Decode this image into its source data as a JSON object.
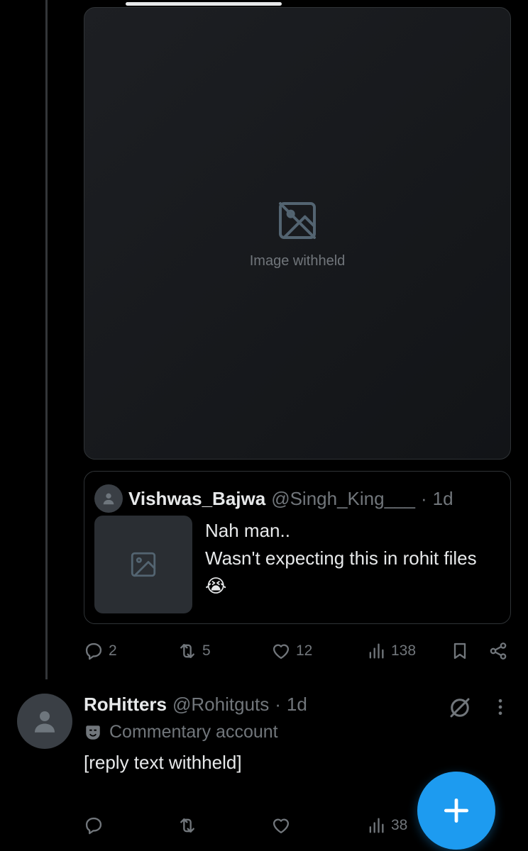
{
  "top_media": {
    "note": "Image withheld"
  },
  "quote": {
    "name": "Vishwas_Bajwa",
    "handle": "@Singh_King___",
    "separator": "·",
    "time": "1d",
    "lines": [
      "Nah man..",
      "Wasn't expecting this in rohit files 😭"
    ]
  },
  "actions": {
    "replies": "2",
    "reposts": "5",
    "likes": "12",
    "views": "138"
  },
  "reply": {
    "name": "RoHitters",
    "handle": "@Rohitguts",
    "separator": "·",
    "time": "1d",
    "badge": "Commentary account",
    "body": "[reply text withheld]",
    "views": "38"
  },
  "icons": {
    "reply": "reply-icon",
    "repost": "repost-icon",
    "like": "like-icon",
    "views": "views-icon",
    "bookmark": "bookmark-icon",
    "share": "share-icon",
    "grok": "grok-icon",
    "more": "more-icon",
    "commentary": "commentary-icon",
    "compose": "compose-icon"
  },
  "colors": {
    "background": "#000000",
    "text": "#e7e9ea",
    "muted": "#71767b",
    "border": "#2f3336",
    "accent": "#1d9bf0"
  }
}
